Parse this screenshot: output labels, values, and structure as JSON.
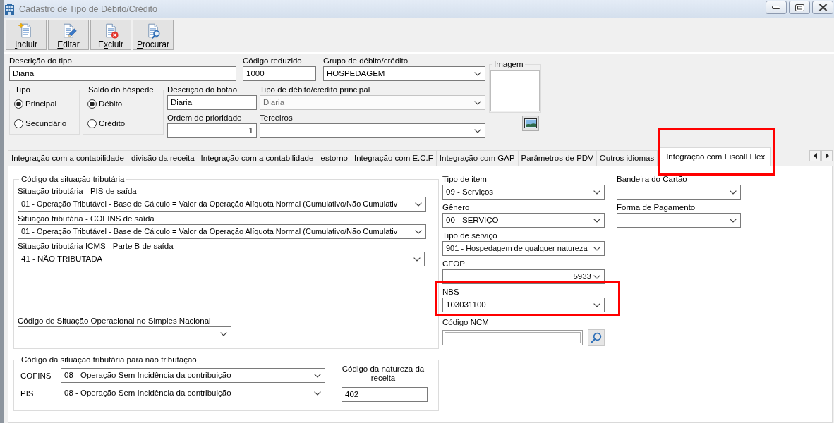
{
  "window": {
    "title": "Cadastro de Tipo de Débito/Crédito"
  },
  "toolbar": [
    {
      "kind": "new",
      "mnemonic": "I",
      "rest": "ncluir"
    },
    {
      "kind": "edit",
      "mnemonic": "E",
      "rest": "ditar"
    },
    {
      "kind": "delete",
      "lead": "E",
      "mnemonic": "x",
      "rest": "cluir"
    },
    {
      "kind": "search",
      "mnemonic": "P",
      "rest": "rocurar"
    }
  ],
  "form": {
    "row_1": [
      {
        "kind": "text",
        "label": "Descrição do tipo",
        "value": "Diaria"
      },
      {
        "kind": "text",
        "label": "Código reduzido",
        "value": "1000"
      },
      {
        "kind": "combo",
        "label": "Grupo de débito/crédito",
        "value": "HOSPEDAGEM"
      }
    ],
    "tipo": {
      "title": "Tipo",
      "options": [
        {
          "label": "Principal",
          "selected": true
        },
        {
          "label": "Secundário",
          "selected": false
        }
      ]
    },
    "saldo_do_hospede": {
      "title": "Saldo do hóspede",
      "options": [
        {
          "label": "Débito",
          "selected": true
        },
        {
          "label": "Crédito",
          "selected": false
        }
      ]
    },
    "column_3": [
      {
        "kind": "text",
        "label": "Descrição do botão",
        "value": "Diaria"
      },
      {
        "kind": "number",
        "label": "Ordem de prioridade",
        "value": "1"
      }
    ],
    "column_4": [
      {
        "kind": "combo",
        "label": "Tipo de débito/crédito principal",
        "value": "Diaria",
        "disabled": true
      },
      {
        "kind": "combo",
        "label": "Terceiros",
        "disabled": false
      }
    ],
    "imagem": {
      "title": "Imagem"
    }
  },
  "tabs": [
    {
      "label": "Integração com a contabilidade - divisão da receita",
      "selected": false,
      "highlighted": false
    },
    {
      "label": "Integração com a contabilidade - estorno",
      "selected": false,
      "highlighted": false
    },
    {
      "label": "Integração com E.C.F",
      "selected": false,
      "highlighted": false
    },
    {
      "label": "Integração com GAP",
      "selected": false,
      "highlighted": false
    },
    {
      "label": "Parâmetros de PDV",
      "selected": false,
      "highlighted": false
    },
    {
      "label": "Outros idiomas",
      "selected": false,
      "highlighted": false
    },
    {
      "label": "Integração com Fiscall Flex",
      "selected": true,
      "highlighted": true
    }
  ],
  "tab_panel": {
    "situacao_tributaria": {
      "title": "Código da situação tributária",
      "fields": [
        {
          "kind": "combo",
          "label": "Situação tributária - PIS de saída",
          "value": "01 - Operação Tributável - Base de Cálculo = Valor da Operação Alíquota Normal (Cumulativo/Não Cumulativ"
        },
        {
          "kind": "combo",
          "label": "Situação tributária - COFINS de saída",
          "value": "01 - Operação Tributável - Base de Cálculo = Valor da Operação Alíquota Normal (Cumulativo/Não Cumulativ"
        },
        {
          "kind": "combo",
          "label": "Situação tributária ICMS - Parte B de saída",
          "value": "41 - NÃO TRIBUTADA"
        }
      ],
      "simples_nacional": {
        "kind": "combo",
        "label": "Código de Situação Operacional no Simples Nacional"
      }
    },
    "nao_tributacao": {
      "title": "Código da situação tributária para não tributação",
      "rows": [
        {
          "label": "COFINS",
          "value": "08 - Operação Sem Incidência da contribuição"
        },
        {
          "label": "PIS",
          "value": "08 - Operação Sem Incidência da contribuição"
        }
      ],
      "natureza_da_receita": {
        "label": "Código da natureza da receita",
        "value": "402"
      }
    },
    "fiscal_fields": [
      {
        "kind": "combo",
        "label": "Tipo de item",
        "value": "09 - Serviços",
        "highlighted": false
      },
      {
        "kind": "combo",
        "label": "Gênero",
        "value": "00 - SERVIÇO",
        "highlighted": false
      },
      {
        "kind": "combo",
        "label": "Tipo de serviço",
        "value": "901 - Hospedagem de qualquer natureza",
        "highlighted": false
      },
      {
        "kind": "number-combo",
        "label": "CFOP",
        "value": "5933",
        "highlighted": false
      },
      {
        "kind": "combo",
        "label": "NBS",
        "value": "103031100",
        "highlighted": true
      },
      {
        "kind": "search",
        "label": "Código NCM",
        "highlighted": false
      }
    ],
    "payment_fields": [
      {
        "kind": "combo",
        "label": "Bandeira do Cartão"
      },
      {
        "kind": "combo",
        "label": "Forma de Pagamento"
      }
    ]
  }
}
